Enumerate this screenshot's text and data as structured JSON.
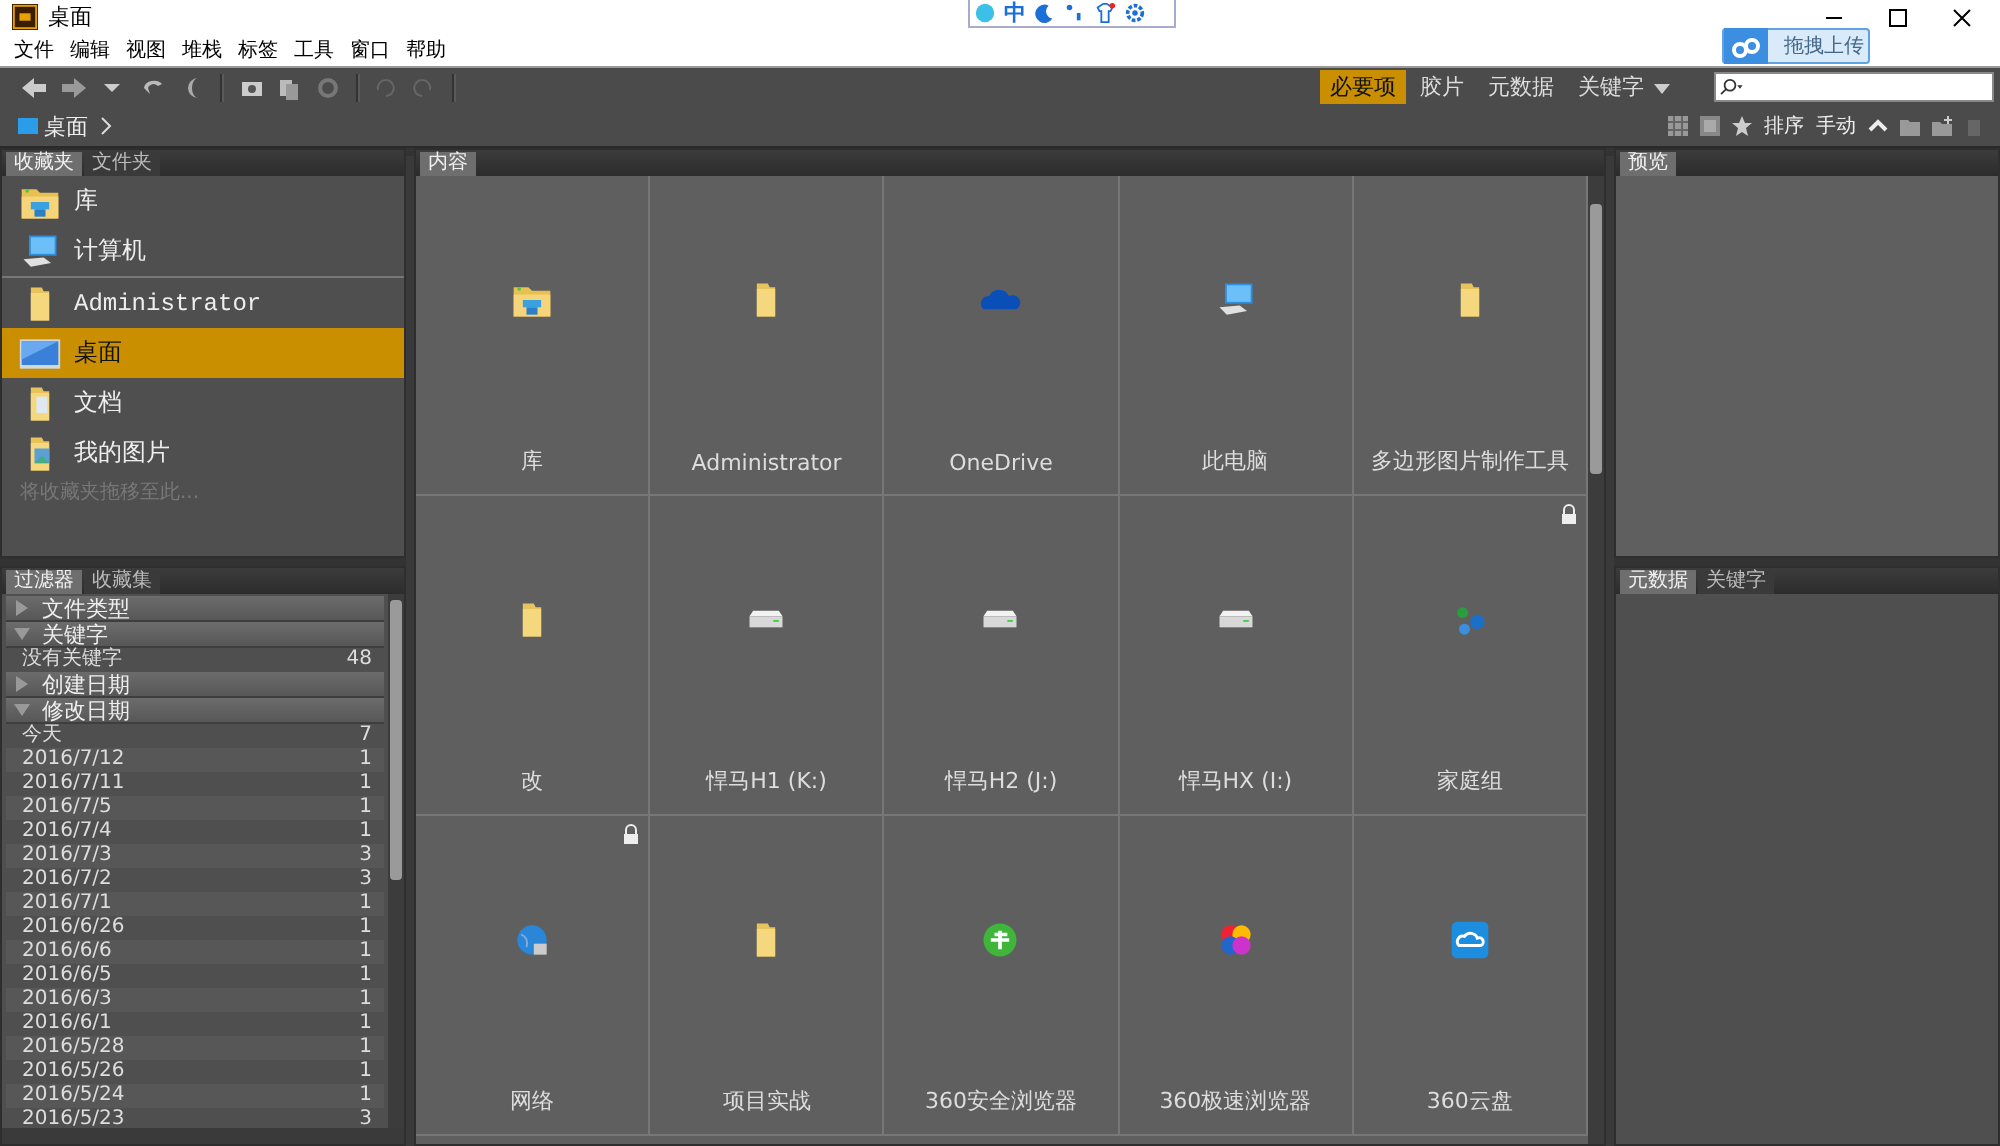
{
  "window": {
    "title": "桌面"
  },
  "ime_toolbar": {
    "mode": "中"
  },
  "upload_button": {
    "label": "拖拽上传"
  },
  "menu": [
    "文件",
    "编辑",
    "视图",
    "堆栈",
    "标签",
    "工具",
    "窗口",
    "帮助"
  ],
  "workspaces": [
    {
      "label": "必要项",
      "selected": true
    },
    {
      "label": "胶片",
      "selected": false
    },
    {
      "label": "元数据",
      "selected": false
    },
    {
      "label": "关键字",
      "selected": false,
      "has_menu": true
    }
  ],
  "path": [
    {
      "label": "桌面"
    }
  ],
  "sort": {
    "label": "排序",
    "value": "手动"
  },
  "favorites_panel": {
    "tabs": [
      {
        "label": "收藏夹",
        "selected": true
      },
      {
        "label": "文件夹",
        "selected": false
      }
    ],
    "items": [
      {
        "label": "库",
        "kind": "library",
        "selected": false,
        "separator_before": false
      },
      {
        "label": "计算机",
        "kind": "computer",
        "selected": false,
        "separator_before": false
      },
      {
        "label": "Administrator",
        "kind": "folder",
        "selected": false,
        "separator_before": true
      },
      {
        "label": "桌面",
        "kind": "desktop",
        "selected": true,
        "separator_before": false
      },
      {
        "label": "文档",
        "kind": "documents",
        "selected": false,
        "separator_before": false
      },
      {
        "label": "我的图片",
        "kind": "pictures",
        "selected": false,
        "separator_before": false
      }
    ],
    "hint": "将收藏夹拖移至此..."
  },
  "filter_panel": {
    "tabs": [
      {
        "label": "过滤器",
        "selected": true
      },
      {
        "label": "收藏集",
        "selected": false
      }
    ],
    "groups": [
      {
        "label": "文件类型",
        "expanded": false
      },
      {
        "label": "关键字",
        "expanded": true,
        "rows": [
          {
            "label": "没有关键字",
            "count": "48"
          }
        ]
      },
      {
        "label": "创建日期",
        "expanded": false
      },
      {
        "label": "修改日期",
        "expanded": true,
        "rows": [
          {
            "label": "今天",
            "count": "7"
          },
          {
            "label": "2016/7/12",
            "count": "1"
          },
          {
            "label": "2016/7/11",
            "count": "1"
          },
          {
            "label": "2016/7/5",
            "count": "1"
          },
          {
            "label": "2016/7/4",
            "count": "1"
          },
          {
            "label": "2016/7/3",
            "count": "3"
          },
          {
            "label": "2016/7/2",
            "count": "3"
          },
          {
            "label": "2016/7/1",
            "count": "1"
          },
          {
            "label": "2016/6/26",
            "count": "1"
          },
          {
            "label": "2016/6/6",
            "count": "1"
          },
          {
            "label": "2016/6/5",
            "count": "1"
          },
          {
            "label": "2016/6/3",
            "count": "1"
          },
          {
            "label": "2016/6/1",
            "count": "1"
          },
          {
            "label": "2016/5/28",
            "count": "1"
          },
          {
            "label": "2016/5/26",
            "count": "1"
          },
          {
            "label": "2016/5/24",
            "count": "1"
          },
          {
            "label": "2016/5/23",
            "count": "3"
          }
        ]
      }
    ]
  },
  "content_panel": {
    "tabs": [
      {
        "label": "内容",
        "selected": true
      }
    ],
    "items": [
      {
        "name": "库",
        "kind": "library",
        "locked": false
      },
      {
        "name": "Administrator",
        "kind": "folder",
        "locked": false
      },
      {
        "name": "OneDrive",
        "kind": "onedrive",
        "locked": false
      },
      {
        "name": "此电脑",
        "kind": "computer",
        "locked": false
      },
      {
        "name": "多边形图片制作工具",
        "kind": "folder",
        "locked": false
      },
      {
        "name": "改",
        "kind": "folder",
        "locked": false
      },
      {
        "name": "悍马H1 (K:)",
        "kind": "drive",
        "locked": false
      },
      {
        "name": "悍马H2 (J:)",
        "kind": "drive",
        "locked": false
      },
      {
        "name": "悍马HX (I:)",
        "kind": "drive",
        "locked": false
      },
      {
        "name": "家庭组",
        "kind": "homegroup",
        "locked": true
      },
      {
        "name": "网络",
        "kind": "network",
        "locked": true
      },
      {
        "name": "项目实战",
        "kind": "folder",
        "locked": false
      },
      {
        "name": "360安全浏览器",
        "kind": "browser",
        "locked": false
      },
      {
        "name": "360极速浏览器",
        "kind": "colorball",
        "locked": false
      },
      {
        "name": "360云盘",
        "kind": "cloud",
        "locked": false
      }
    ]
  },
  "preview_panel": {
    "tabs": [
      {
        "label": "预览",
        "selected": true
      }
    ]
  },
  "metadata_panel": {
    "tabs": [
      {
        "label": "元数据",
        "selected": true
      },
      {
        "label": "关键字",
        "selected": false
      }
    ]
  }
}
